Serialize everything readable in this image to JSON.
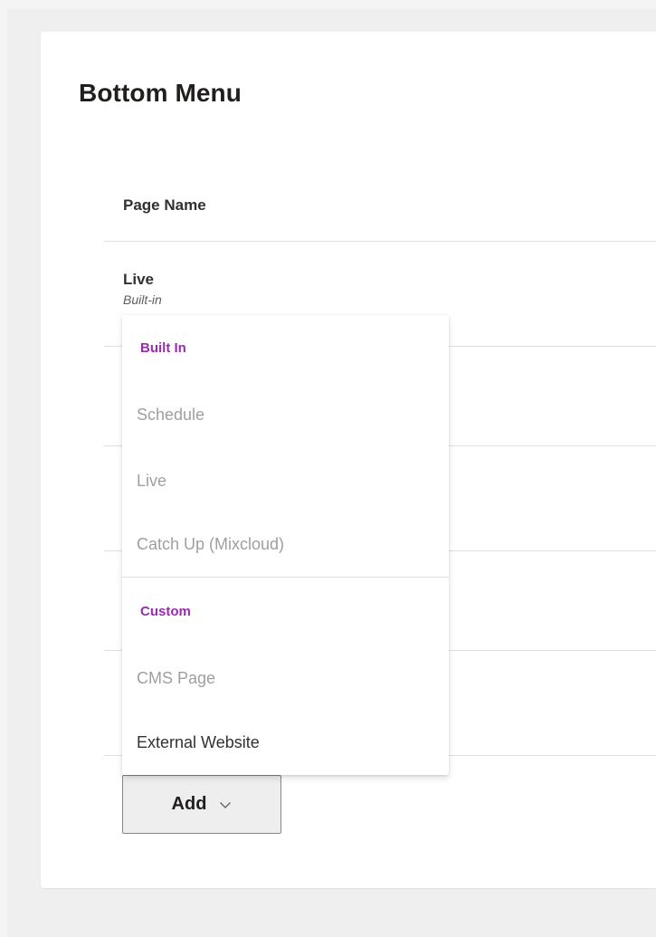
{
  "panel": {
    "title": "Bottom Menu"
  },
  "table": {
    "column_header": "Page Name",
    "rows": [
      {
        "name": "Live",
        "subtitle": "Built-in"
      }
    ]
  },
  "add_button": {
    "label": "Add",
    "icon": "chevron-down-icon"
  },
  "dropdown": {
    "sections": [
      {
        "header": "Built In",
        "items": [
          {
            "label": "Schedule",
            "enabled": false
          },
          {
            "label": "Live",
            "enabled": false
          },
          {
            "label": "Catch Up (Mixcloud)",
            "enabled": false
          }
        ]
      },
      {
        "header": "Custom",
        "items": [
          {
            "label": "CMS Page",
            "enabled": false
          },
          {
            "label": "External Website",
            "enabled": true
          }
        ]
      }
    ]
  },
  "colors": {
    "section_header": "#9c2ab0",
    "disabled_text": "#a19f9d",
    "enabled_text": "#323130"
  }
}
